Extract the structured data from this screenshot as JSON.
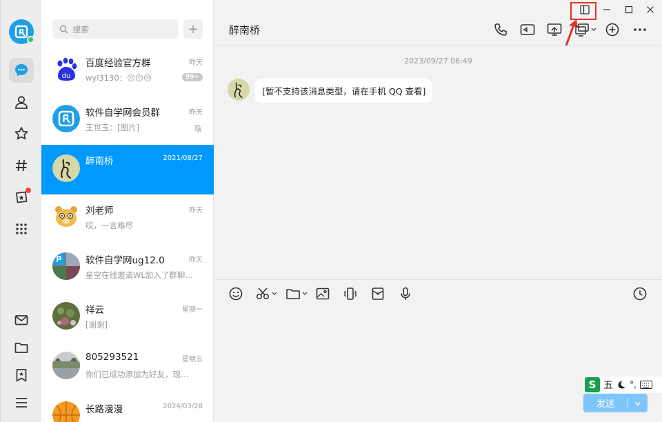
{
  "search": {
    "placeholder": "搜索",
    "add": "+"
  },
  "conversations": [
    {
      "name": "百度经验官方群",
      "time": "昨天",
      "preview": "wyl3130：😒😒😒",
      "badge": "99+"
    },
    {
      "name": "软件自学网会员群",
      "time": "昨天",
      "preview": "王世玉：[图片]",
      "muted": true
    },
    {
      "name": "醉南桥",
      "time": "2021/08/27",
      "preview": "",
      "selected": true
    },
    {
      "name": "刘老师",
      "time": "昨天",
      "preview": "哎，一言难尽"
    },
    {
      "name": "软件自学网ug12.0",
      "time": "昨天",
      "preview": "星空在线邀请WL加入了群聊…"
    },
    {
      "name": "祥云",
      "time": "星期一",
      "preview": "[谢谢]"
    },
    {
      "name": "805293521",
      "time": "星期五",
      "preview": "你们已成功添加为好友，现…"
    },
    {
      "name": "长路漫漫",
      "time": "2024/03/28",
      "preview": ""
    }
  ],
  "chat": {
    "title": "醉南桥",
    "timestamp": "2023/09/27 06:49",
    "message": "[暂不支持该消息类型，请在手机 QQ 查看]"
  },
  "send": {
    "label": "发送"
  },
  "ime": {
    "logo": "S",
    "mode": "五",
    "punct": "°,"
  },
  "colors": {
    "accent": "#0099ff",
    "highlight": "#e8302a",
    "online": "#3cc86a"
  }
}
